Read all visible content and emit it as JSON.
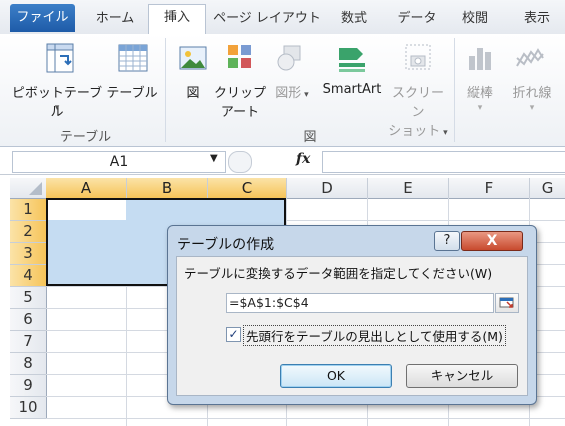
{
  "ribbon": {
    "tabs": [
      "ファイル",
      "ホーム",
      "挿入",
      "ページ レイアウト",
      "数式",
      "データ",
      "校閲",
      "表示"
    ],
    "buttons": {
      "pivot": "ピボットテーブル",
      "table": "テーブル",
      "picture": "図",
      "clipart_1": "クリップ",
      "clipart_2": "アート",
      "shapes": "図形",
      "smartart": "SmartArt",
      "screenshot_1": "スクリーン",
      "screenshot_2": "ショット",
      "column": "縦棒",
      "line": "折れ線"
    },
    "groups": {
      "tables": "テーブル",
      "illustrations": "図"
    }
  },
  "formula_bar": {
    "name_box": "A1",
    "fx": "fx",
    "formula": ""
  },
  "grid": {
    "columns": [
      "A",
      "B",
      "C",
      "D",
      "E",
      "F",
      "G"
    ],
    "rows": [
      "1",
      "2",
      "3",
      "4",
      "5",
      "6",
      "7",
      "8",
      "9",
      "10"
    ],
    "selected_columns": [
      "A",
      "B",
      "C"
    ],
    "selected_rows": [
      "1",
      "2",
      "3",
      "4"
    ]
  },
  "dialog": {
    "title": "テーブルの作成",
    "help": "?",
    "close": "X",
    "range_label": "テーブルに変換するデータ範囲を指定してください(W)",
    "range_value": "=$A$1:$C$4",
    "header_checkbox_label": "先頭行をテーブルの見出しとして使用する(M)",
    "header_checked": true,
    "ok": "OK",
    "cancel": "キャンセル"
  },
  "colors": {
    "accent": "#1e5ba8",
    "selection": "#c5dcf2",
    "header_sel": "#f6c459"
  }
}
